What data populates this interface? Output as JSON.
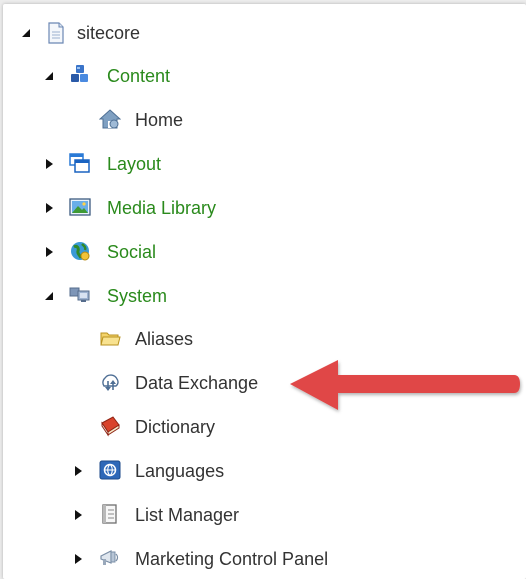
{
  "tree": {
    "root": {
      "label": "sitecore",
      "icon": "page-icon",
      "expanded": true
    },
    "content": {
      "label": "Content",
      "icon": "content-cubes-icon",
      "expanded": true
    },
    "home": {
      "label": "Home",
      "icon": "home-icon"
    },
    "layout": {
      "label": "Layout",
      "icon": "layout-windows-icon",
      "expanded": false
    },
    "media_library": {
      "label": "Media Library",
      "icon": "picture-icon",
      "expanded": false
    },
    "social": {
      "label": "Social",
      "icon": "globe-icon",
      "expanded": false
    },
    "system": {
      "label": "System",
      "icon": "system-computers-icon",
      "expanded": true
    },
    "aliases": {
      "label": "Aliases",
      "icon": "folder-icon"
    },
    "data_exchange": {
      "label": "Data Exchange",
      "icon": "data-exchange-icon"
    },
    "dictionary": {
      "label": "Dictionary",
      "icon": "book-icon"
    },
    "languages": {
      "label": "Languages",
      "icon": "languages-icon",
      "expanded": false
    },
    "list_manager": {
      "label": "List Manager",
      "icon": "list-manager-icon",
      "expanded": false
    },
    "marketing_control_panel": {
      "label": "Marketing Control Panel",
      "icon": "marketing-icon",
      "expanded": false
    }
  },
  "annotation": {
    "icon": "red-arrow-icon",
    "color": "#e04646"
  },
  "colors": {
    "green_label": "#2a8a1c",
    "dark_label": "#333333"
  }
}
